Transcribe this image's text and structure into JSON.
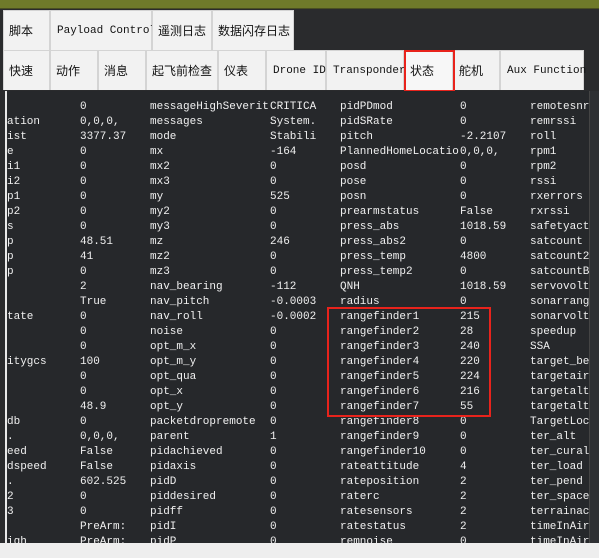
{
  "tabs_row1": [
    "脚本",
    "Payload Control",
    "遥测日志",
    "数据闪存日志"
  ],
  "tabs_row2": [
    "快速",
    "动作",
    "消息",
    "起飞前检查",
    "仪表",
    "Drone ID",
    "Transponder",
    "状态",
    "舵机",
    "Aux Function"
  ],
  "active_tab": "状态",
  "highlight_color": "#e8231c",
  "rows": [
    [
      "",
      "0",
      "messageHighSeverit",
      "CRITICA",
      "pidPDmod",
      "0",
      "remotesnrd"
    ],
    [
      "ation",
      "0,0,0,",
      "messages",
      "System.",
      "pidSRate",
      "0",
      "remrssi"
    ],
    [
      "ist",
      "3377.37",
      "mode",
      "Stabili",
      "pitch",
      "-2.2107",
      "roll"
    ],
    [
      "e",
      "0",
      "mx",
      "-164",
      "PlannedHomeLocatio",
      "0,0,0,",
      "rpm1"
    ],
    [
      "i1",
      "0",
      "mx2",
      "0",
      "posd",
      "0",
      "rpm2"
    ],
    [
      "i2",
      "0",
      "mx3",
      "0",
      "pose",
      "0",
      "rssi"
    ],
    [
      "p1",
      "0",
      "my",
      "525",
      "posn",
      "0",
      "rxerrors"
    ],
    [
      "p2",
      "0",
      "my2",
      "0",
      "prearmstatus",
      "False",
      "rxrssi"
    ],
    [
      "s",
      "0",
      "my3",
      "0",
      "press_abs",
      "1018.59",
      "safetyacti"
    ],
    [
      "p",
      "48.51",
      "mz",
      "246",
      "press_abs2",
      "0",
      "satcount"
    ],
    [
      "p",
      "41",
      "mz2",
      "0",
      "press_temp",
      "4800",
      "satcount2"
    ],
    [
      "p",
      "0",
      "mz3",
      "0",
      "press_temp2",
      "0",
      "satcountB"
    ],
    [
      "",
      "2",
      "nav_bearing",
      "-112",
      "QNH",
      "1018.59",
      "servovolta"
    ],
    [
      "",
      "True",
      "nav_pitch",
      "-0.0003",
      "radius",
      "0",
      "sonarrange"
    ],
    [
      "tate",
      "0",
      "nav_roll",
      "-0.0002",
      "rangefinder1",
      "215",
      "sonarvolta"
    ],
    [
      "",
      "0",
      "noise",
      "0",
      "rangefinder2",
      "28",
      "speedup"
    ],
    [
      "",
      "0",
      "opt_m_x",
      "0",
      "rangefinder3",
      "240",
      "SSA"
    ],
    [
      "itygcs",
      "100",
      "opt_m_y",
      "0",
      "rangefinder4",
      "220",
      "target_bea"
    ],
    [
      "",
      "0",
      "opt_qua",
      "0",
      "rangefinder5",
      "224",
      "targetairs"
    ],
    [
      "",
      "0",
      "opt_x",
      "0",
      "rangefinder6",
      "216",
      "targetalt"
    ],
    [
      "",
      "48.9",
      "opt_y",
      "0",
      "rangefinder7",
      "55",
      "targetaltd"
    ],
    [
      "db",
      "0",
      "packetdropremote",
      "0",
      "rangefinder8",
      "0",
      "TargetLoca"
    ],
    [
      ".",
      "0,0,0,",
      "parent",
      "1",
      "rangefinder9",
      "0",
      "ter_alt"
    ],
    [
      "eed",
      "False",
      "pidachieved",
      "0",
      "rangefinder10",
      "0",
      "ter_curalt"
    ],
    [
      "dspeed",
      "False",
      "pidaxis",
      "0",
      "rateattitude",
      "4",
      "ter_load"
    ],
    [
      ".",
      "602.525",
      "pidD",
      "0",
      "rateposition",
      "2",
      "ter_pend"
    ],
    [
      "2",
      "0",
      "piddesired",
      "0",
      "raterc",
      "2",
      "ter_space"
    ],
    [
      "3",
      "0",
      "pidff",
      "0",
      "ratesensors",
      "2",
      "terrainact"
    ],
    [
      "",
      "PreArm:",
      "pidI",
      "0",
      "ratestatus",
      "2",
      "timeInAir"
    ],
    [
      "igh",
      "PreArm:",
      "pidP",
      "0",
      "remnoise",
      "0",
      "timeInAirM"
    ]
  ]
}
